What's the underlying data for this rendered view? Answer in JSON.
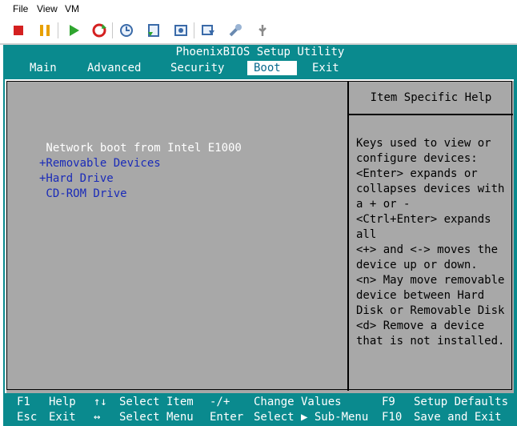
{
  "menu": {
    "file": "File",
    "view": "View",
    "vm": "VM"
  },
  "toolbar": {
    "icons": [
      "stop-icon",
      "pause-icon",
      "play-icon",
      "reset-icon",
      "snapshot-icon",
      "revert-icon",
      "manage-snapshots-icon",
      "send-keys-icon",
      "settings-icon",
      "usb-icon"
    ]
  },
  "bios": {
    "title": "PhoenixBIOS Setup Utility",
    "tabs": [
      "Main",
      "Advanced",
      "Security",
      "Boot",
      "Exit"
    ],
    "active_tab": "Boot",
    "boot_items": [
      {
        "label": " Network boot from Intel E1000",
        "selected": true
      },
      {
        "label": "+Removable Devices",
        "selected": false
      },
      {
        "label": "+Hard Drive",
        "selected": false
      },
      {
        "label": " CD-ROM Drive",
        "selected": false
      }
    ],
    "help_title": "Item Specific Help",
    "help_lines": [
      "Keys used to view or",
      "configure devices:",
      "<Enter> expands or",
      "collapses devices with",
      "a + or -",
      "<Ctrl+Enter> expands",
      "all",
      "<+> and <-> moves the",
      "device up or down.",
      "<n> May move removable",
      "device between Hard",
      "Disk or Removable Disk",
      "<d> Remove a device",
      "that is not installed."
    ],
    "legend": {
      "f1": "F1",
      "help": "Help",
      "updown": "↑↓",
      "select_item": "Select Item",
      "minus_plus": "-/+",
      "change_values": "Change Values",
      "f9": "F9",
      "setup_defaults": "Setup Defaults",
      "esc": "Esc",
      "exit": "Exit",
      "leftright": "↔",
      "select_menu": "Select Menu",
      "enter": "Enter",
      "select_submenu": "Select ▶ Sub-Menu",
      "f10": "F10",
      "save_exit": "Save and Exit"
    }
  },
  "colors": {
    "bios_bg": "#0a8a8e",
    "panel_bg": "#a8a8a8",
    "item_blue": "#1a2bb8"
  }
}
